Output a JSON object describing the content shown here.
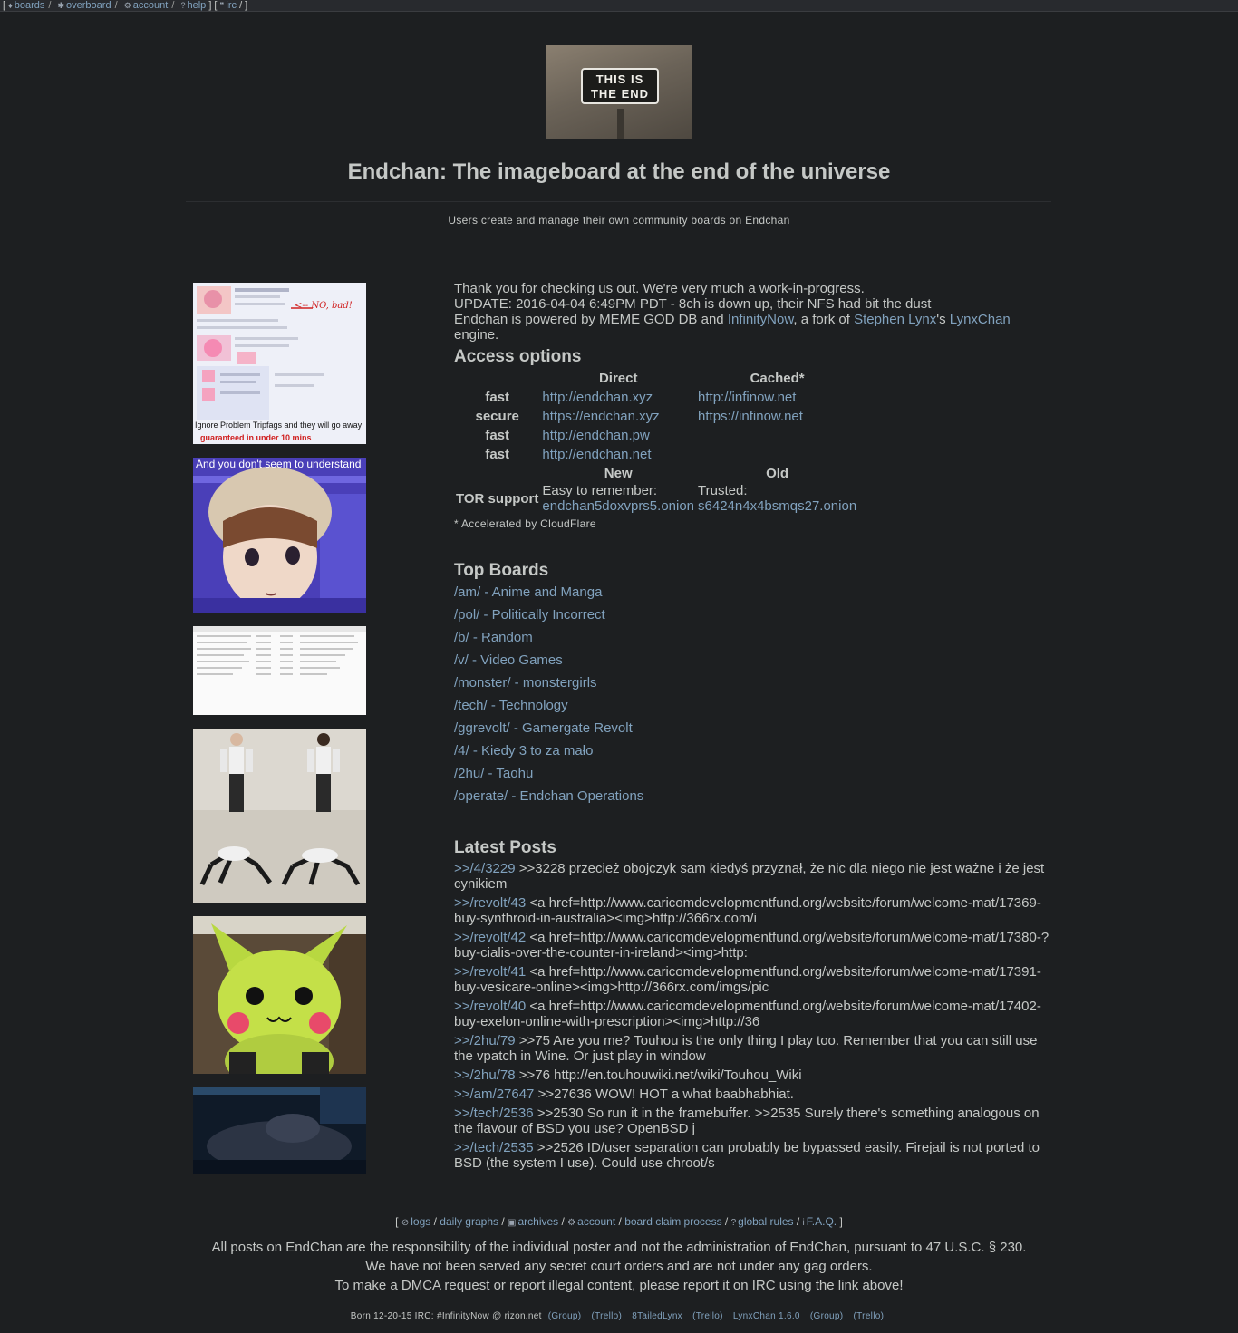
{
  "topnav": {
    "open": "[",
    "items": [
      {
        "icon": "tag-icon",
        "label": "boards"
      },
      {
        "icon": "asterisk-icon",
        "label": "overboard"
      },
      {
        "icon": "gear-icon",
        "label": "account"
      },
      {
        "icon": "question-icon",
        "label": "help"
      }
    ],
    "mid": "] [",
    "irc": {
      "icon": "quote-icon",
      "label": "irc"
    },
    "close": "/ ]"
  },
  "banner": {
    "sign_text": "THIS IS THE END"
  },
  "header": {
    "title": "Endchan: The imageboard at the end of the universe",
    "subtitle": "Users create and manage their own community boards on Endchan"
  },
  "intro": {
    "line1": "Thank you for checking us out. We're very much a work-in-progress.",
    "update_pre": "UPDATE: 2016-04-04 6:49PM PDT - 8ch is ",
    "update_strike": "down",
    "update_post": " up, their NFS had bit the dust",
    "powered_pre": "Endchan is powered by MEME GOD DB and ",
    "link_infinitynow": "InfinityNow",
    "powered_mid": ", a fork of ",
    "link_stephen": "Stephen Lynx",
    "powered_apos": "'s ",
    "link_lynxchan": "LynxChan",
    "powered_end": " engine."
  },
  "access": {
    "heading": "Access options",
    "col_direct": "Direct",
    "col_cached": "Cached*",
    "rows": [
      {
        "label": "fast",
        "direct": "http://endchan.xyz",
        "cached": "http://infinow.net"
      },
      {
        "label": "secure",
        "direct": "https://endchan.xyz",
        "cached": "https://infinow.net"
      },
      {
        "label": "fast",
        "direct": "http://endchan.pw",
        "cached": ""
      },
      {
        "label": "fast",
        "direct": "http://endchan.net",
        "cached": ""
      }
    ],
    "col_new": "New",
    "col_old": "Old",
    "tor_label": "TOR support",
    "tor_new_text": "Easy to remember:",
    "tor_new_link": "endchan5doxvprs5.onion",
    "tor_old_text": "Trusted:",
    "tor_old_link": "s6424n4x4bsmqs27.onion",
    "note": "* Accelerated by CloudFlare"
  },
  "top_boards": {
    "heading": "Top Boards",
    "items": [
      "/am/ - Anime and Manga",
      "/pol/ - Politically Incorrect",
      "/b/ - Random",
      "/v/ - Video Games",
      "/monster/ - monstergirls",
      "/tech/ - Technology",
      "/ggrevolt/ - Gamergate Revolt",
      "/4/ - Kiedy 3 to za mało",
      "/2hu/ - Taohu",
      "/operate/ - Endchan Operations"
    ]
  },
  "latest_posts": {
    "heading": "Latest Posts",
    "items": [
      {
        "link": ">>/4/3229",
        "text": " >>3228 przecież obojczyk sam kiedyś przyznał, że nic dla niego nie jest ważne i że jest cynikiem"
      },
      {
        "link": ">>/revolt/43",
        "text": " <a href=http://www.caricomdevelopmentfund.org/website/forum/welcome-mat/17369-buy-synthroid-in-australia><img>http://366rx.com/i"
      },
      {
        "link": ">>/revolt/42",
        "text": " <a href=http://www.caricomdevelopmentfund.org/website/forum/welcome-mat/17380-?buy-cialis-over-the-counter-in-ireland><img>http:"
      },
      {
        "link": ">>/revolt/41",
        "text": " <a href=http://www.caricomdevelopmentfund.org/website/forum/welcome-mat/17391-buy-vesicare-online><img>http://366rx.com/imgs/pic"
      },
      {
        "link": ">>/revolt/40",
        "text": " <a href=http://www.caricomdevelopmentfund.org/website/forum/welcome-mat/17402-buy-exelon-online-with-prescription><img>http://36"
      },
      {
        "link": ">>/2hu/79",
        "text": " >>75 Are you me? Touhou is the only thing I play too. Remember that you can still use the vpatch in Wine. Or just play in window"
      },
      {
        "link": ">>/2hu/78",
        "text": " >>76 http://en.touhouwiki.net/wiki/Touhou_Wiki"
      },
      {
        "link": ">>/am/27647",
        "text": " >>27636 WOW! HOT a what baabhabhiat."
      },
      {
        "link": ">>/tech/2536",
        "text": " >>2530 So run it in the framebuffer. >>2535 Surely there's something analogous on the flavour of BSD you use? OpenBSD j"
      },
      {
        "link": ">>/tech/2535",
        "text": " >>2526 ID/user separation can probably be bypassed easily. Firejail is not ported to BSD (the system I use). Could use chroot/s"
      }
    ]
  },
  "thumbnails": {
    "t1_caption": "Ignore Problem Tripfags and they will go away",
    "t1_subcaption": "guaranteed in under 10 mins",
    "t1_note": "<-- NO, bad!",
    "t2_caption": "And you don't seem to understand"
  },
  "footer_nav": {
    "open": "[",
    "items": [
      {
        "icon": "ban-icon",
        "label": "logs"
      },
      {
        "icon": "",
        "label": "daily graphs"
      },
      {
        "icon": "archive-icon",
        "label": "archives"
      },
      {
        "icon": "gear-icon",
        "label": "account"
      },
      {
        "icon": "",
        "label": "board claim process"
      },
      {
        "icon": "question-icon",
        "label": "global rules"
      },
      {
        "icon": "info-icon",
        "label": "F.A.Q."
      }
    ],
    "close": "]"
  },
  "legal": {
    "line1": "All posts on EndChan are the responsibility of the individual poster and not the administration of EndChan, pursuant to 47 U.S.C. § 230.",
    "line2": "We have not been served any secret court orders and are not under any gag orders.",
    "line3": "To make a DMCA request or report illegal content, please report it on IRC using the link above!"
  },
  "credits": {
    "text": "Born 12-20-15 IRC: #InfinityNow @ rizon.net",
    "links": [
      "(Group)",
      "(Trello)",
      "8TailedLynx",
      "(Trello)",
      "LynxChan 1.6.0",
      "(Group)",
      "(Trello)"
    ]
  },
  "colors": {
    "background": "#1d1f21",
    "text": "#c5c8c6",
    "link": "#81a2be"
  }
}
